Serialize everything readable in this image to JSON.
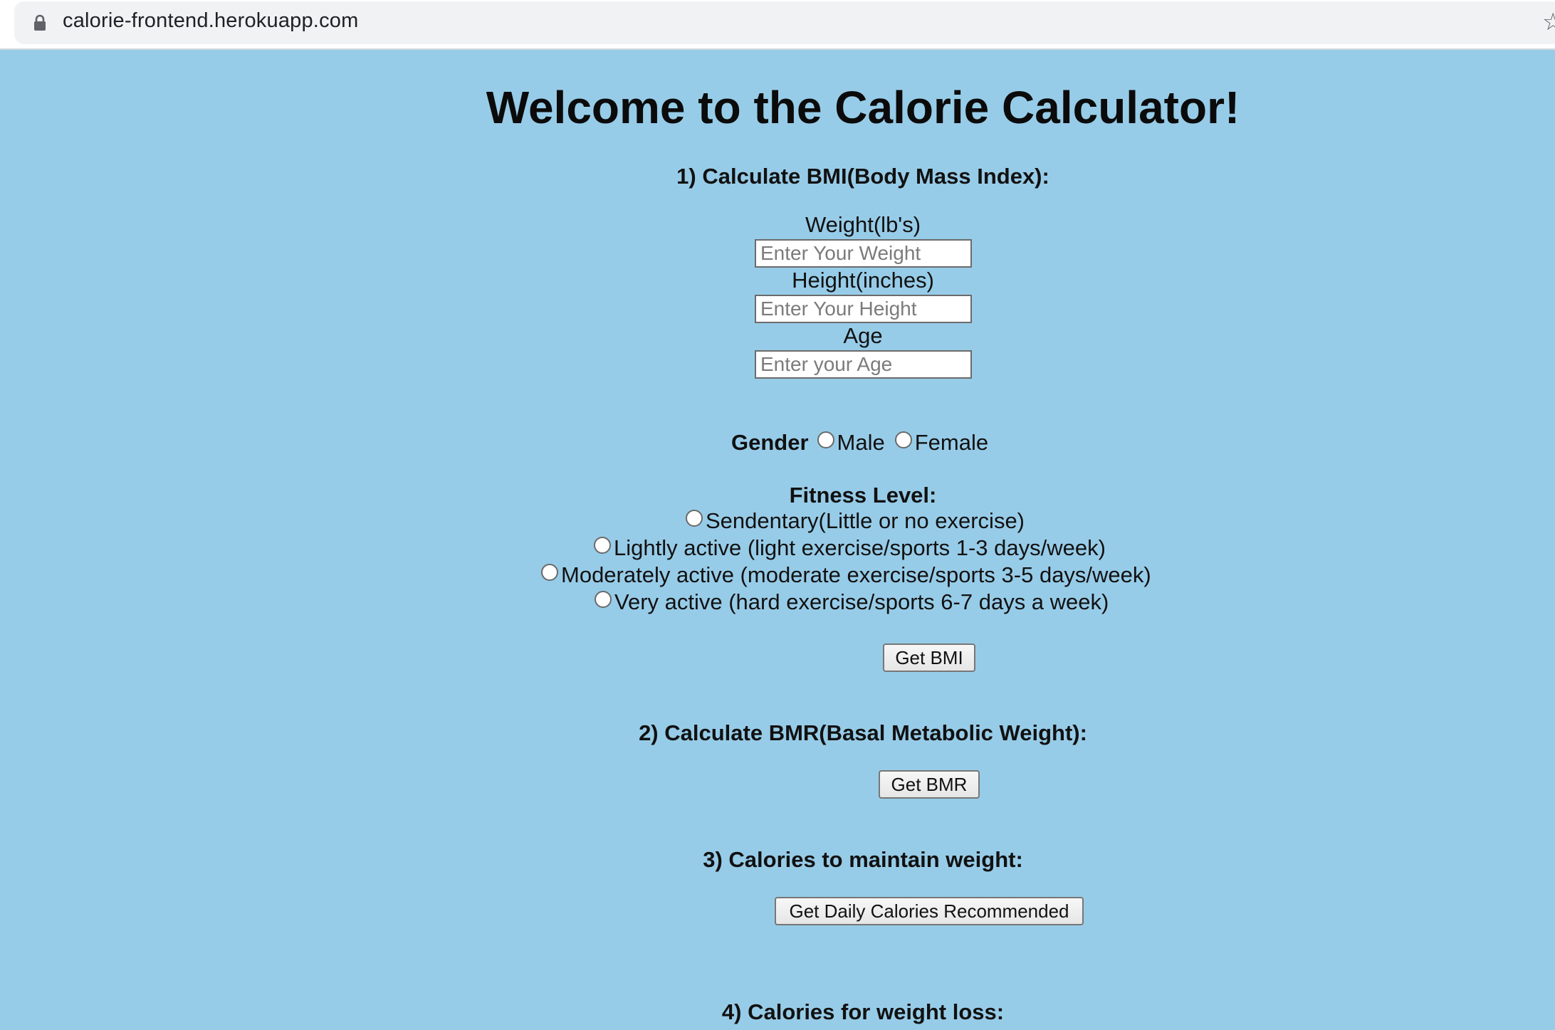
{
  "browser": {
    "url": "calorie-frontend.herokuapp.com",
    "lock_icon": "lock-icon",
    "bookmark_icon": "star-icon"
  },
  "colors": {
    "page_background": "#97cce8",
    "address_bar": "#f0f2f4"
  },
  "page": {
    "title": "Welcome to the Calorie Calculator!"
  },
  "bmi": {
    "heading": "1) Calculate BMI(Body Mass Index):",
    "weight": {
      "label": "Weight(lb's)",
      "placeholder": "Enter Your Weight",
      "value": ""
    },
    "height": {
      "label": "Height(inches)",
      "placeholder": "Enter Your Height",
      "value": ""
    },
    "age": {
      "label": "Age",
      "placeholder": "Enter your Age",
      "value": ""
    },
    "gender": {
      "label": "Gender",
      "options": [
        "Male",
        "Female"
      ]
    },
    "fitness": {
      "label": "Fitness Level:",
      "options": [
        "Sendentary(Little or no exercise)",
        "Lightly active (light exercise/sports 1-3 days/week)",
        "Moderately active (moderate exercise/sports 3-5 days/week)",
        "Very active (hard exercise/sports 6-7 days a week)"
      ]
    },
    "button": "Get BMI"
  },
  "bmr": {
    "heading": "2) Calculate BMR(Basal Metabolic Weight):",
    "button": "Get BMR"
  },
  "maintain": {
    "heading": "3) Calories to maintain weight:",
    "button": "Get Daily Calories Recommended"
  },
  "loss": {
    "heading": "4) Calories for weight loss:"
  }
}
